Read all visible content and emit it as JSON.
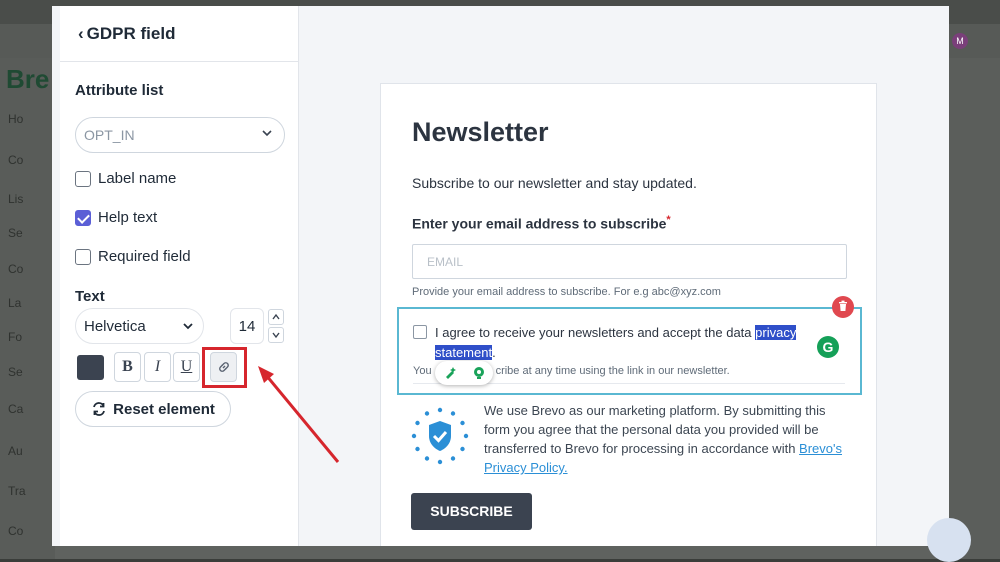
{
  "background": {
    "logo_text": "Bre",
    "sidebar_items": [
      "Ho",
      "Co",
      "Lis",
      "Se",
      "Co",
      "La",
      "Fo",
      "Se",
      "Ca",
      "Au",
      "Tra",
      "Co"
    ],
    "avatar": "M"
  },
  "panel": {
    "title": "GDPR field",
    "attribute_list_title": "Attribute list",
    "attribute_select_value": "OPT_IN",
    "label_name": "Label name",
    "label_name_checked": false,
    "help_text": "Help text",
    "help_text_checked": true,
    "required_field": "Required field",
    "required_field_checked": false,
    "text_section_title": "Text",
    "font_value": "Helvetica",
    "font_size": "14",
    "bold_label": "B",
    "italic_label": "I",
    "underline_label": "U",
    "reset_label": "Reset element",
    "text_color": "#3b4350",
    "highlight_color": "#d6262d"
  },
  "form": {
    "title": "Newsletter",
    "subtitle": "Subscribe to our newsletter and stay updated.",
    "email_label": "Enter your email address to subscribe",
    "required_marker": "*",
    "email_placeholder": "EMAIL",
    "email_help": "Provide your email address to subscribe. For e.g abc@xyz.com",
    "gdpr_text_before": "I agree to receive your newsletters and accept the data ",
    "gdpr_text_highlight_1": "privacy",
    "gdpr_text_highlight_2": "statement",
    "gdpr_text_after": ".",
    "gdpr_help_start": "You",
    "gdpr_help_end": "cribe at any time using the link in our newsletter.",
    "privacy_text": "We use Brevo as our marketing platform. By submitting this form you agree that the personal data you provided will be transferred to Brevo for processing in accordance with ",
    "privacy_link_1": "Brevo's",
    "privacy_link_2": "Privacy Policy.",
    "subscribe_label": "SUBSCRIBE",
    "grammarly_letter": "G"
  }
}
